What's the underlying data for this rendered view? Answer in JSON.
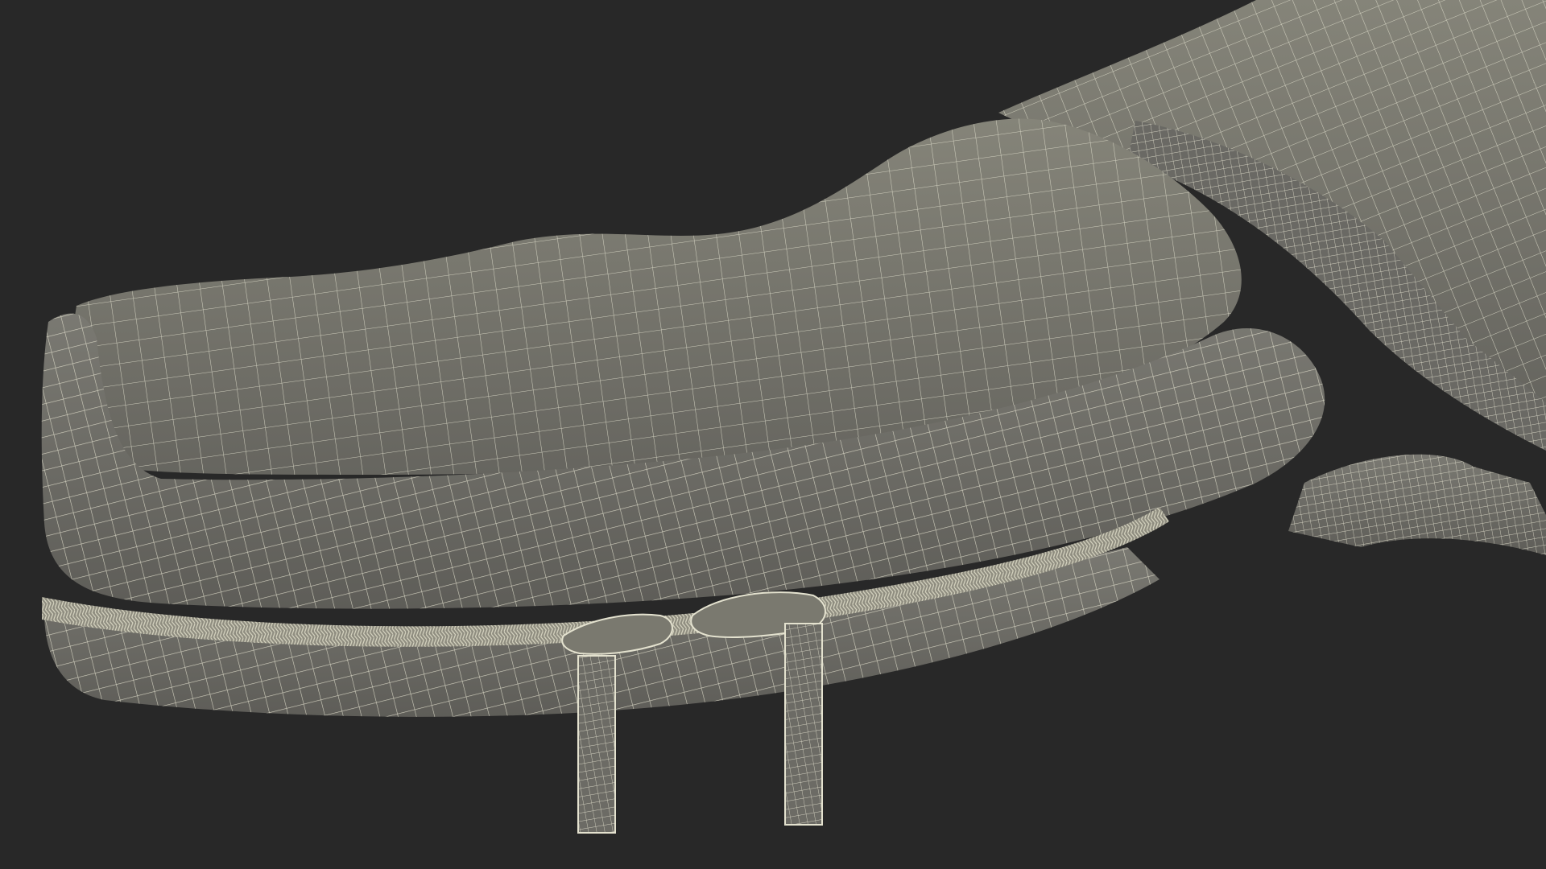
{
  "scene": {
    "subject": "sling-bag-wireframe",
    "colors": {
      "background": "#282828",
      "surface": "#6f6e69",
      "surface_light": "#858479",
      "surface_dark": "#5c5b56",
      "wire": "#e4e2cf",
      "zipper": "#a9a797"
    }
  }
}
